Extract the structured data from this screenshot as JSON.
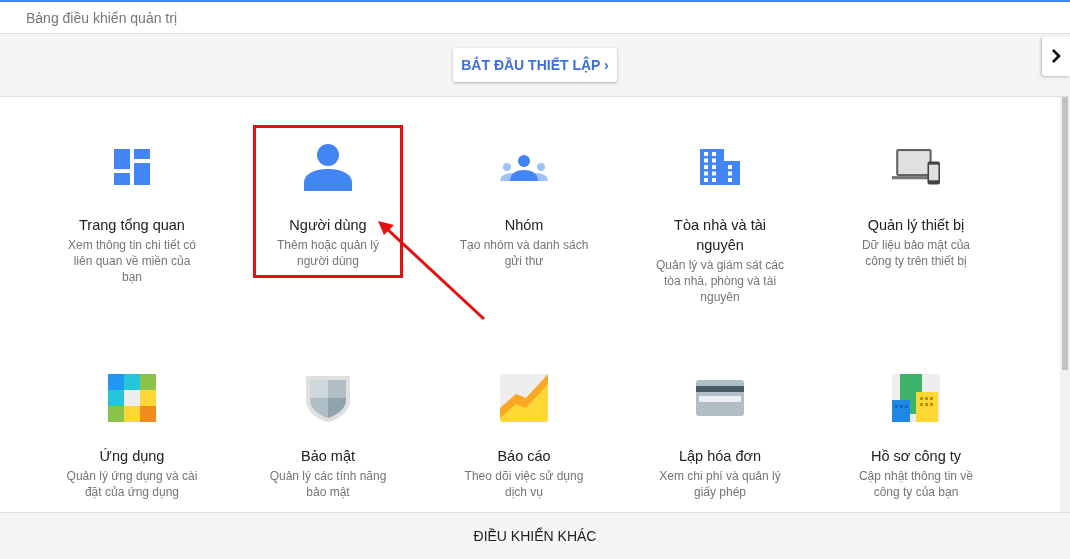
{
  "header": {
    "title": "Bảng điều khiển quản trị"
  },
  "toolbar": {
    "setup_button": "BẮT ĐẦU THIẾT LẬP ›"
  },
  "cards": [
    {
      "title": "Trang tổng quan",
      "description": "Xem thông tin chi tiết có liên quan về miền của bạn",
      "highlighted": false
    },
    {
      "title": "Người dùng",
      "description": "Thêm hoặc quản lý người dùng",
      "highlighted": true
    },
    {
      "title": "Nhóm",
      "description": "Tạo nhóm và danh sách gửi thư",
      "highlighted": false
    },
    {
      "title": "Tòa nhà và tài nguyên",
      "description": "Quản lý và giám sát các tòa nhà, phòng và tài nguyên",
      "highlighted": false
    },
    {
      "title": "Quản lý thiết bị",
      "description": "Dữ liệu bảo mật của công ty trên thiết bị",
      "highlighted": false
    },
    {
      "title": "Ứng dụng",
      "description": "Quản lý ứng dụng và cài đặt của ứng dụng",
      "highlighted": false
    },
    {
      "title": "Bảo mật",
      "description": "Quản lý các tính năng bảo mật",
      "highlighted": false
    },
    {
      "title": "Báo cáo",
      "description": "Theo dõi việc sử dụng dịch vụ",
      "highlighted": false
    },
    {
      "title": "Lập hóa đơn",
      "description": "Xem chi phí và quản lý giấy phép",
      "highlighted": false
    },
    {
      "title": "Hồ sơ công ty",
      "description": "Cập nhật thông tin về công ty của bạn",
      "highlighted": false
    }
  ],
  "footer": {
    "label": "ĐIỀU KHIỂN KHÁC"
  }
}
